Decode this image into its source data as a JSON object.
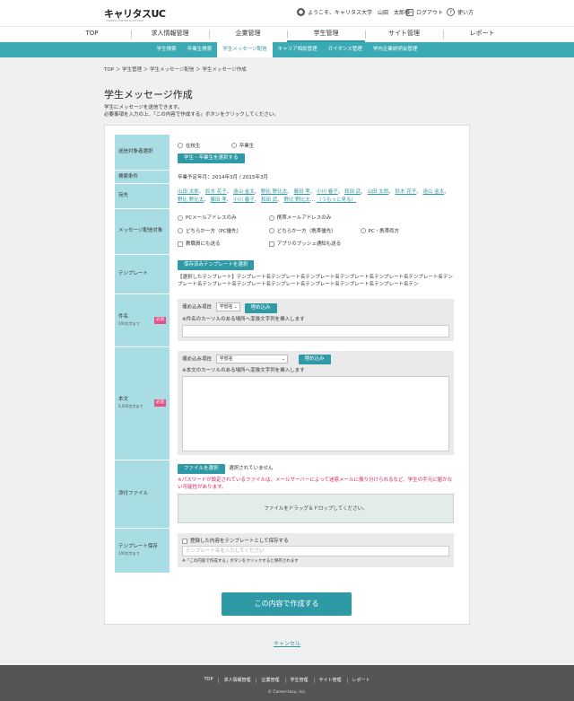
{
  "header": {
    "logo": "キャリタスUC",
    "logo_sub": "CAREER CENTER PLATFORM",
    "welcome": "ようこそ、キャリタス大学　山田　太郎様",
    "logout": "ログアウト",
    "help": "使い方",
    "user_icon": "user-icon",
    "logout_icon": "logout-icon",
    "help_icon": "help-icon"
  },
  "main_nav": [
    "TOP",
    "求人情報管理",
    "企業管理",
    "学生管理",
    "サイト管理",
    "レポート"
  ],
  "main_nav_active": 3,
  "sub_nav": [
    "学生検索",
    "卒業生検索",
    "学生メッセージ配信",
    "キャリア相談管理",
    "ガイダンス管理",
    "学内企業説明会管理"
  ],
  "sub_nav_active": 2,
  "breadcrumb": "TOP ＞ 学生管理 ＞ 学生メッセージ配信 ＞ 学生メッセージ作成",
  "page_title": "学生メッセージ作成",
  "description": {
    "line1": "学生にメッセージを送信できます。",
    "line2": "必要事項を入力の上、「この内容で作成する」ボタンをクリックしてください。"
  },
  "form": {
    "target": {
      "label": "送信対象者選択",
      "option_current": "在校生",
      "option_graduate": "卒業生",
      "button": "学生・卒業生を選択する"
    },
    "criteria": {
      "label": "検索条件",
      "value": "卒業予定年月：2014年3月 / 2015年3月"
    },
    "recipients": {
      "label": "宛先",
      "names": [
        "山田 太郎",
        "鈴木 花子",
        "遠山 金太",
        "野比 野比太",
        "藤田 孝",
        "小川 春子",
        "和田 武",
        "山田 太郎",
        "鈴木 花子",
        "遠山 金太",
        "野比 野比太",
        "藤田 孝",
        "小川 春子",
        "和田 武",
        "野比 野比太"
      ],
      "more": "（うもっと見る）"
    },
    "delivery": {
      "label": "メッセージ配信対象",
      "options": [
        "PCメールアドレスのみ",
        "携帯メールアドレスのみ",
        "どちらか一方（PC優先）",
        "どちらか一方（携帯優先）",
        "PC・携帯両方"
      ],
      "check_staff": "教職員にも送る",
      "check_push": "アプリのプッシュ通知も送る"
    },
    "template": {
      "label": "テンプレート",
      "button": "保存済みテンプレートを選択",
      "selected_prefix": "【選択したテンプレート】",
      "selected_text": "テンプレート名テンプレート名テンプレート名テンプレート名テンプレート名テンプレート名テンプレート名テンプレート名テンプレート名テンプレート名テンプレート名テンプレート名テンプレート名テン"
    },
    "subject": {
      "label": "件名",
      "limit": "200文字まで",
      "required": "必須",
      "embed_label": "埋め込み項目",
      "embed_select": "学部名",
      "embed_button": "埋め込み",
      "hint": "※件名のカーソルのある場所へ変換文字列を挿入します",
      "value": ""
    },
    "body": {
      "label": "本文",
      "limit": "5,000文字まで",
      "required": "必須",
      "embed_label": "埋め込み項目",
      "embed_select": "学部名",
      "embed_button": "埋め込み",
      "hint": "※本文のカーソルのある場所へ変換文字列を挿入します",
      "value": ""
    },
    "attachment": {
      "label": "添付ファイル",
      "button": "ファイルを選択",
      "status": "選択されていません",
      "warning": "※パスワードが設定されているファイルは、メールサーバーによって迷惑メールに振り分けられるなど、学生の手元に届かない可能性があります。",
      "dropzone": "ファイルをドラッグ＆ドロップしてください。"
    },
    "save_template": {
      "label": "テンプレート保存",
      "limit": "100文字まで",
      "checkbox": "登録した内容をテンプレートとして保存する",
      "placeholder": "テンプレート名を入力してください",
      "note": "※「この内容で作成する」ボタンをクリックすると保存されます"
    }
  },
  "submit": "この内容で作成する",
  "cancel": "キャンセル",
  "footer": {
    "links": [
      "TOP",
      "求人情報管理",
      "企業管理",
      "学生管理",
      "サイト管理",
      "レポート"
    ],
    "copyright": "© Career-tasu, Inc."
  },
  "colors": {
    "accent": "#2e9aa6",
    "subnav": "#3aaab5",
    "label_bg": "#a8dde3",
    "required": "#e8508a",
    "warning": "#d81b60",
    "footer": "#555555"
  }
}
